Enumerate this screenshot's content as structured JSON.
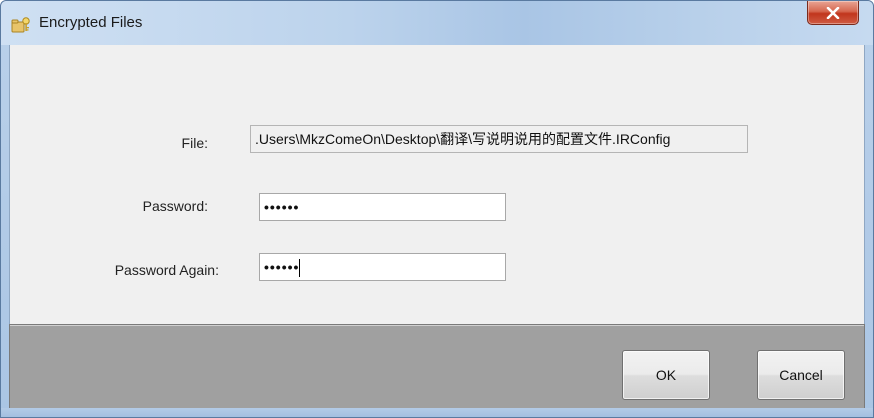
{
  "window": {
    "title": "Encrypted Files",
    "icon": "key-folder-icon",
    "close_icon": "close-icon"
  },
  "form": {
    "file_label": "File:",
    "file_value": ".Users\\MkzComeOn\\Desktop\\翻译\\写说明说用的配置文件.IRConfig",
    "password_label": "Password:",
    "password_value": "••••••",
    "password_again_label": "Password Again:",
    "password_again_value": "••••••"
  },
  "buttons": {
    "ok_label": "OK",
    "cancel_label": "Cancel"
  },
  "colors": {
    "close_button": "#c1361d",
    "footer_bg": "#a0a0a0",
    "client_bg": "#f0f0f0"
  }
}
